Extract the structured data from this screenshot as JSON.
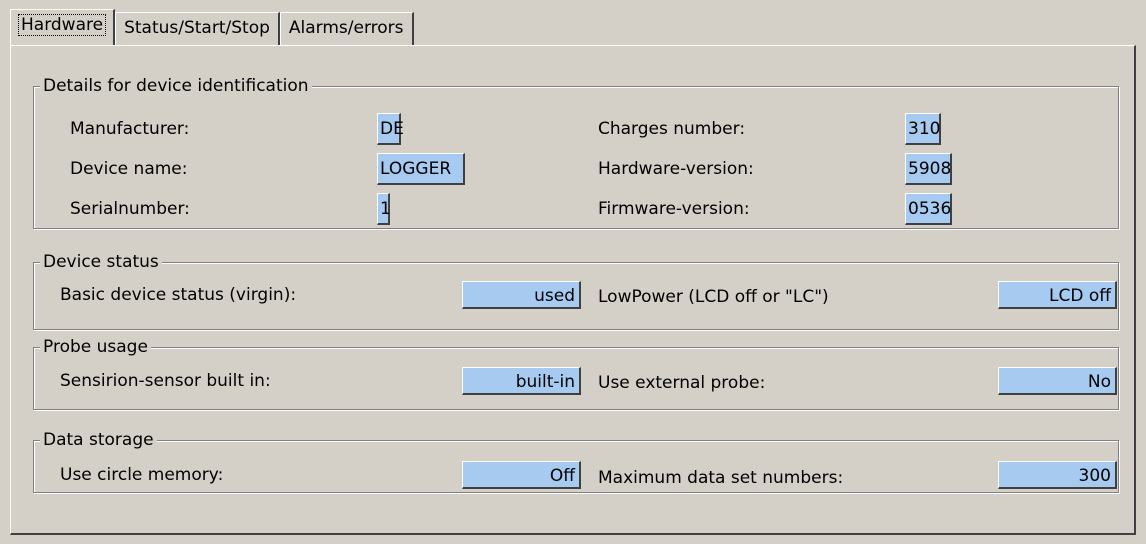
{
  "tabs": [
    "Hardware",
    "Status/Start/Stop",
    "Alarms/errors"
  ],
  "identification": {
    "title": "Details for device identification",
    "manufacturer_label": "Manufacturer:",
    "manufacturer_value": "DE",
    "device_name_label": "Device name:",
    "device_name_value": "LOGGER",
    "serial_label": "Serialnumber:",
    "serial_value": "1",
    "charges_label": "Charges number:",
    "charges_value": "310",
    "hardware_label": "Hardware-version:",
    "hardware_value": "5908",
    "firmware_label": "Firmware-version:",
    "firmware_value": "0536"
  },
  "device_status": {
    "title": "Device status",
    "basic_label": "Basic device status (virgin):",
    "basic_value": "used",
    "lowpower_label": "LowPower (LCD off or \"LC\")",
    "lowpower_value": "LCD off"
  },
  "probe_usage": {
    "title": "Probe usage",
    "sensirion_label": "Sensirion-sensor built in:",
    "sensirion_value": "built-in",
    "external_label": "Use external probe:",
    "external_value": "No"
  },
  "data_storage": {
    "title": "Data storage",
    "circle_label": "Use circle memory:",
    "circle_value": "Off",
    "max_label": "Maximum data set numbers:",
    "max_value": "300"
  }
}
